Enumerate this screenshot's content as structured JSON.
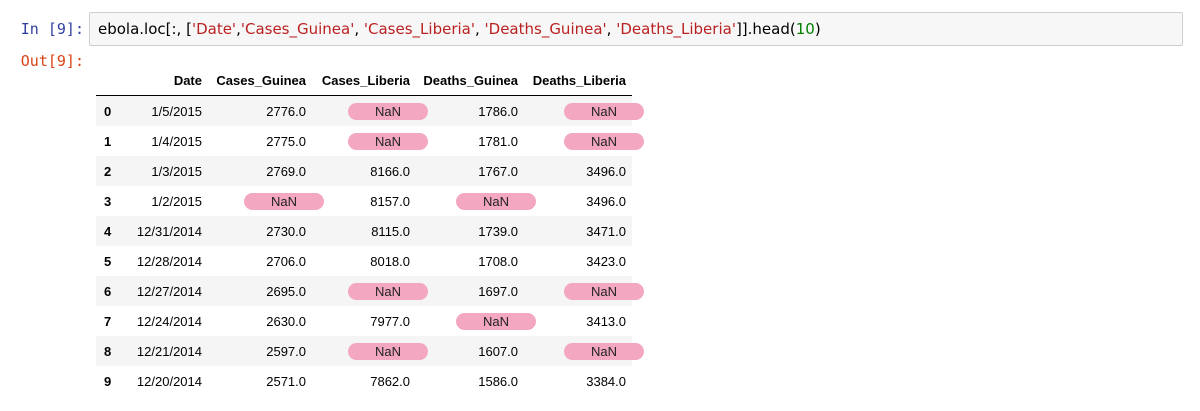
{
  "cell": {
    "in_prompt": "In [9]:",
    "out_prompt": "Out[9]:",
    "code": {
      "p1": "ebola.loc[:, [",
      "s1": "'Date'",
      "c1": ",",
      "s2": "'Cases_Guinea'",
      "c2": ", ",
      "s3": "'Cases_Liberia'",
      "c3": ", ",
      "s4": "'Deaths_Guinea'",
      "c4": ", ",
      "s5": "'Deaths_Liberia'",
      "p2": "]].head(",
      "n1": "10",
      "p3": ")"
    }
  },
  "colors": {
    "nan_highlight": "#f3a7c1",
    "in_prompt": "#303f9f",
    "out_prompt": "#d84315",
    "string": "#ba2121",
    "number": "#008000"
  },
  "table": {
    "columns": [
      "Date",
      "Cases_Guinea",
      "Cases_Liberia",
      "Deaths_Guinea",
      "Deaths_Liberia"
    ],
    "rows": [
      {
        "index": "0",
        "date": "1/5/2015",
        "cg": "2776.0",
        "cl": "NaN",
        "dg": "1786.0",
        "dl": "NaN"
      },
      {
        "index": "1",
        "date": "1/4/2015",
        "cg": "2775.0",
        "cl": "NaN",
        "dg": "1781.0",
        "dl": "NaN"
      },
      {
        "index": "2",
        "date": "1/3/2015",
        "cg": "2769.0",
        "cl": "8166.0",
        "dg": "1767.0",
        "dl": "3496.0"
      },
      {
        "index": "3",
        "date": "1/2/2015",
        "cg": "NaN",
        "cl": "8157.0",
        "dg": "NaN",
        "dl": "3496.0"
      },
      {
        "index": "4",
        "date": "12/31/2014",
        "cg": "2730.0",
        "cl": "8115.0",
        "dg": "1739.0",
        "dl": "3471.0"
      },
      {
        "index": "5",
        "date": "12/28/2014",
        "cg": "2706.0",
        "cl": "8018.0",
        "dg": "1708.0",
        "dl": "3423.0"
      },
      {
        "index": "6",
        "date": "12/27/2014",
        "cg": "2695.0",
        "cl": "NaN",
        "dg": "1697.0",
        "dl": "NaN"
      },
      {
        "index": "7",
        "date": "12/24/2014",
        "cg": "2630.0",
        "cl": "7977.0",
        "dg": "NaN",
        "dl": "3413.0"
      },
      {
        "index": "8",
        "date": "12/21/2014",
        "cg": "2597.0",
        "cl": "NaN",
        "dg": "1607.0",
        "dl": "NaN"
      },
      {
        "index": "9",
        "date": "12/20/2014",
        "cg": "2571.0",
        "cl": "7862.0",
        "dg": "1586.0",
        "dl": "3384.0"
      }
    ]
  }
}
